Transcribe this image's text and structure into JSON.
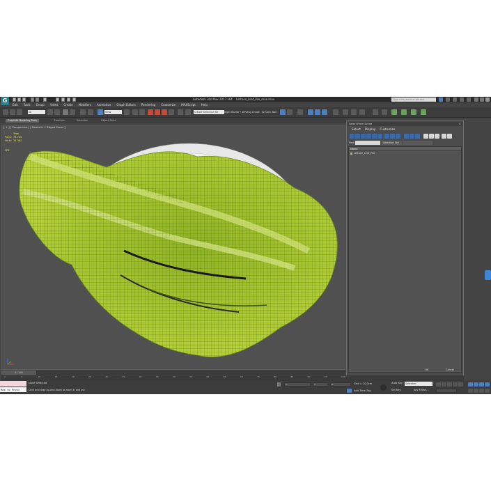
{
  "window": {
    "title": "Autodesk 3ds Max 2017 x64",
    "filename": "Lettuce_Leaf_Pile_max.max",
    "search_placeholder": "Type a keyword or phrase"
  },
  "menu": [
    "Edit",
    "Tools",
    "Group",
    "Views",
    "Create",
    "Modifiers",
    "Animation",
    "Graph Editors",
    "Rendering",
    "Customize",
    "MAXScript",
    "Help"
  ],
  "toolbar": {
    "filter_value": "All",
    "view_value": "View",
    "selection_set_placeholder": "Create Selection Se",
    "text1": "Ingel Studio • eleveny Check",
    "text2": "Jiz Cam Tool"
  },
  "ribbon": {
    "tabs": [
      "Graphite Modeling Tools",
      "Freeform",
      "Selection",
      "Object Paint"
    ]
  },
  "viewport": {
    "label": "[ + ] [ Perspective ] [ Realistic + Edged Faces ]",
    "stats": {
      "total_label": "Total",
      "polys_label": "Polys:",
      "polys_value": "78 700",
      "verts_label": "Verts:",
      "verts_value": "35 362",
      "fps_label": "FPS:"
    }
  },
  "scene_explorer": {
    "title": "Select From Scene",
    "close": "×",
    "menu": [
      "Select",
      "Display",
      "Customize"
    ],
    "find_label": "Find:",
    "selection_set_label": "Selection Set:",
    "column_header": "Name",
    "items": [
      "Lettuce_Leaf_Pile"
    ],
    "ok_label": "OK",
    "cancel_label": "Cancel"
  },
  "timeline": {
    "slider_label": "0 / 100",
    "ticks": [
      "0",
      "5",
      "10",
      "15",
      "20",
      "25",
      "30",
      "35",
      "40",
      "45",
      "50",
      "55",
      "60",
      "65",
      "70",
      "75",
      "80",
      "85",
      "90",
      "95",
      "100"
    ]
  },
  "status": {
    "maxscript_text": "Max to Physc",
    "selection": "None Selected",
    "prompt": "Click and drag up-and-down to zoom in and out",
    "x_label": "X:",
    "y_label": "Y:",
    "z_label": "Z:",
    "grid": "Grid = 10,0cm",
    "add_time_tag": "Add Time Tag",
    "auto_key": "Auto Key",
    "set_key": "Set Key",
    "selected": "Selected",
    "key_filters": "Key Filters..."
  },
  "colors": {
    "lettuce": "#9bbf2c",
    "lettuce_dark": "#5d7f16",
    "viewport_bg": "#505050",
    "accent": "#4f7fbf",
    "stats_text": "#e8e84a"
  }
}
